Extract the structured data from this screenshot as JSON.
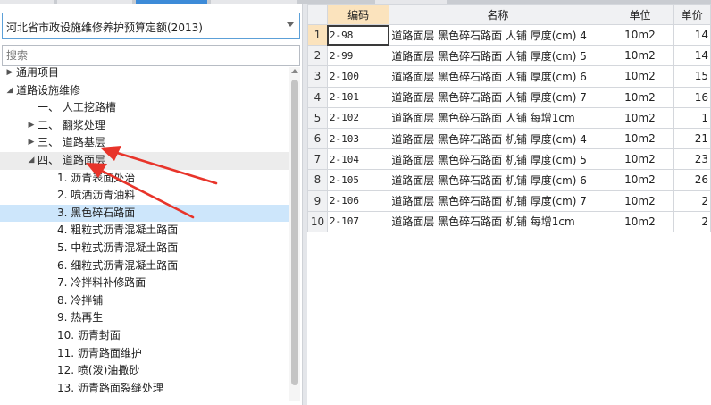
{
  "left": {
    "dropdown_value": "河北省市政设施维修养护预算定额(2013)",
    "search_placeholder": "搜索",
    "tree": [
      {
        "label": "通用项目",
        "indent": 0,
        "arrow": "▶"
      },
      {
        "label": "道路设施维修",
        "indent": 0,
        "arrow": "◢"
      },
      {
        "label": "一、 人工挖路槽",
        "indent": 1,
        "arrow": ""
      },
      {
        "label": "二、 翻浆处理",
        "indent": 1,
        "arrow": "▶"
      },
      {
        "label": "三、 道路基层",
        "indent": 1,
        "arrow": "▶"
      },
      {
        "label": "四、 道路面层",
        "indent": 1,
        "arrow": "◢",
        "state": "hovered"
      },
      {
        "label": "1. 沥青表面处治",
        "indent": 2,
        "arrow": ""
      },
      {
        "label": "2. 喷洒沥青油料",
        "indent": 2,
        "arrow": ""
      },
      {
        "label": "3. 黑色碎石路面",
        "indent": 2,
        "arrow": "",
        "state": "selected"
      },
      {
        "label": "4. 粗粒式沥青混凝土路面",
        "indent": 2,
        "arrow": ""
      },
      {
        "label": "5. 中粒式沥青混凝土路面",
        "indent": 2,
        "arrow": ""
      },
      {
        "label": "6. 细粒式沥青混凝土路面",
        "indent": 2,
        "arrow": ""
      },
      {
        "label": "7. 冷拌料补修路面",
        "indent": 2,
        "arrow": ""
      },
      {
        "label": "8. 冷拌铺",
        "indent": 2,
        "arrow": ""
      },
      {
        "label": "9. 热再生",
        "indent": 2,
        "arrow": ""
      },
      {
        "label": "10. 沥青封面",
        "indent": 2,
        "arrow": ""
      },
      {
        "label": "11. 沥青路面维护",
        "indent": 2,
        "arrow": ""
      },
      {
        "label": "12. 喷(泼)油撒砂",
        "indent": 2,
        "arrow": ""
      },
      {
        "label": "13. 沥青路面裂缝处理",
        "indent": 2,
        "arrow": ""
      }
    ]
  },
  "grid": {
    "headers": {
      "num": "",
      "code": "编码",
      "name": "名称",
      "unit": "单位",
      "price": "单价"
    },
    "rows": [
      {
        "num": "1",
        "code": "2-98",
        "name": "道路面层 黑色碎石路面 人铺 厚度(cm) 4",
        "unit": "10m2",
        "price": "14"
      },
      {
        "num": "2",
        "code": "2-99",
        "name": "道路面层 黑色碎石路面 人铺 厚度(cm) 5",
        "unit": "10m2",
        "price": "14"
      },
      {
        "num": "3",
        "code": "2-100",
        "name": "道路面层 黑色碎石路面 人铺 厚度(cm) 6",
        "unit": "10m2",
        "price": "15"
      },
      {
        "num": "4",
        "code": "2-101",
        "name": "道路面层 黑色碎石路面 人铺 厚度(cm) 7",
        "unit": "10m2",
        "price": "16"
      },
      {
        "num": "5",
        "code": "2-102",
        "name": "道路面层 黑色碎石路面 人铺 每增1cm",
        "unit": "10m2",
        "price": "1"
      },
      {
        "num": "6",
        "code": "2-103",
        "name": "道路面层 黑色碎石路面 机铺 厚度(cm) 4",
        "unit": "10m2",
        "price": "21"
      },
      {
        "num": "7",
        "code": "2-104",
        "name": "道路面层 黑色碎石路面 机铺 厚度(cm) 5",
        "unit": "10m2",
        "price": "23"
      },
      {
        "num": "8",
        "code": "2-105",
        "name": "道路面层 黑色碎石路面 机铺 厚度(cm) 6",
        "unit": "10m2",
        "price": "26"
      },
      {
        "num": "9",
        "code": "2-106",
        "name": "道路面层 黑色碎石路面 机铺 厚度(cm) 7",
        "unit": "10m2",
        "price": "2"
      },
      {
        "num": "10",
        "code": "2-107",
        "name": "道路面层 黑色碎石路面 机铺 每增1cm",
        "unit": "10m2",
        "price": "2"
      }
    ]
  },
  "colors": {
    "accent": "#3d8bd8",
    "selected_row": "#cde6fb",
    "active_header": "#fbe3bd",
    "annotation_arrow": "#e8342a"
  }
}
